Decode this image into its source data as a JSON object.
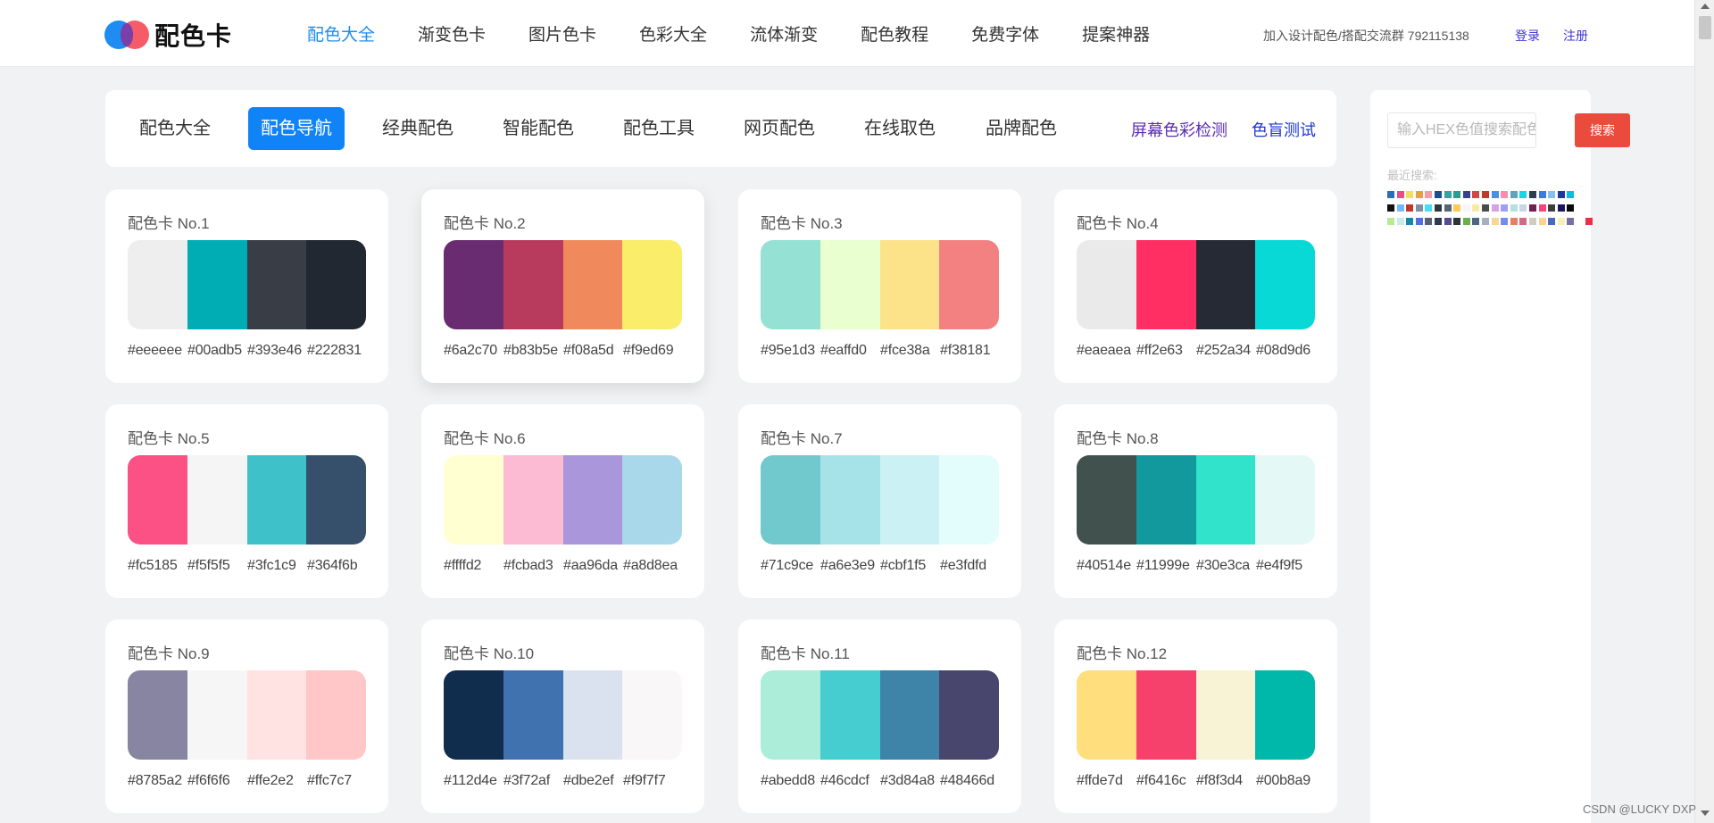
{
  "header": {
    "logo_text": "配色卡",
    "nav": [
      "配色大全",
      "渐变色卡",
      "图片色卡",
      "色彩大全",
      "流体渐变",
      "配色教程",
      "免费字体",
      "提案神器"
    ],
    "join_text": "加入设计配色/搭配交流群 792115138",
    "login": "登录",
    "register": "注册"
  },
  "subnav": {
    "tabs": [
      "配色大全",
      "配色导航",
      "经典配色",
      "智能配色",
      "配色工具",
      "网页配色",
      "在线取色",
      "品牌配色"
    ],
    "active_tab": "配色导航",
    "screen_detect": "屏幕色彩检测",
    "color_blind_test": "色盲测试"
  },
  "cards": [
    {
      "title": "配色卡 No.1",
      "colors": [
        "#eeeeee",
        "#00adb5",
        "#393e46",
        "#222831"
      ]
    },
    {
      "title": "配色卡 No.2",
      "colors": [
        "#6a2c70",
        "#b83b5e",
        "#f08a5d",
        "#f9ed69"
      ]
    },
    {
      "title": "配色卡 No.3",
      "colors": [
        "#95e1d3",
        "#eaffd0",
        "#fce38a",
        "#f38181"
      ]
    },
    {
      "title": "配色卡 No.4",
      "colors": [
        "#eaeaea",
        "#ff2e63",
        "#252a34",
        "#08d9d6"
      ]
    },
    {
      "title": "配色卡 No.5",
      "colors": [
        "#fc5185",
        "#f5f5f5",
        "#3fc1c9",
        "#364f6b"
      ]
    },
    {
      "title": "配色卡 No.6",
      "colors": [
        "#ffffd2",
        "#fcbad3",
        "#aa96da",
        "#a8d8ea"
      ]
    },
    {
      "title": "配色卡 No.7",
      "colors": [
        "#71c9ce",
        "#a6e3e9",
        "#cbf1f5",
        "#e3fdfd"
      ]
    },
    {
      "title": "配色卡 No.8",
      "colors": [
        "#40514e",
        "#11999e",
        "#30e3ca",
        "#e4f9f5"
      ]
    },
    {
      "title": "配色卡 No.9",
      "colors": [
        "#8785a2",
        "#f6f6f6",
        "#ffe2e2",
        "#ffc7c7"
      ]
    },
    {
      "title": "配色卡 No.10",
      "colors": [
        "#112d4e",
        "#3f72af",
        "#dbe2ef",
        "#f9f7f7"
      ]
    },
    {
      "title": "配色卡 No.11",
      "colors": [
        "#abedd8",
        "#46cdcf",
        "#3d84a8",
        "#48466d"
      ]
    },
    {
      "title": "配色卡 No.12",
      "colors": [
        "#ffde7d",
        "#f6416c",
        "#f8f3d4",
        "#00b8a9"
      ]
    }
  ],
  "search": {
    "placeholder": "输入HEX色值搜索配色",
    "button": "搜索",
    "recent_label": "最近搜索:",
    "recent_colors": [
      [
        "#2a6fb5",
        "#e64f86",
        "#f1e05b",
        "#e6a23c",
        "#f39ba8",
        "#1f4e8c",
        "#39a3a3",
        "#2d9c8f",
        "#3a3f8f",
        "#d64541",
        "#c0392b",
        "#4a90e2",
        "#f78fb3",
        "#60a3bc",
        "#1dd1e6",
        "#2c3e50",
        "#3b7dd8",
        "#85c1e9",
        "#1e3799",
        "#0fb9e6"
      ],
      [
        "#111111",
        "#74b9ff",
        "#c0392b",
        "#7f8fa6",
        "#48dbfb",
        "#2f3640",
        "#576574",
        "#feca57",
        "#f5f6fa",
        "#f8e9a1",
        "#4b4b4b",
        "#d6a2e8",
        "#a29bfe",
        "#b2e0e3",
        "#c8d6e5",
        "#6d214f",
        "#fc427b",
        "#3d3d3d",
        "#1b1464",
        "#0a0a0a"
      ],
      [
        "#b8e994",
        "#c7ecee",
        "#1289a7",
        "#546de5",
        "#596275",
        "#303952",
        "#574b90",
        "#2d3436",
        "#6ab04c",
        "#4b6584",
        "#a5b1c2",
        "#f7d794",
        "#778beb",
        "#e77f67",
        "#cf6a87",
        "#d1ccc0",
        "#fad390",
        "#4a69bd",
        "#f8efba",
        "#786fa6",
        "#ffffff",
        "#eb2f46"
      ]
    ]
  },
  "watermark": "CSDN @LUCKY DXP"
}
